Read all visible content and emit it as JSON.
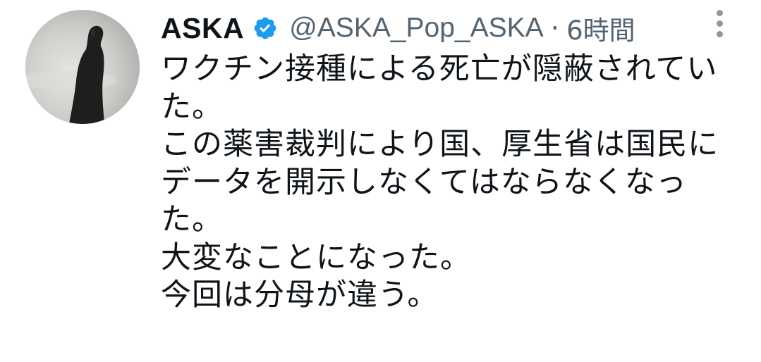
{
  "author": {
    "display_name": "ASKA",
    "handle": "@ASKA_Pop_ASKA",
    "separator": "·",
    "timestamp": "6時間",
    "verified_icon": "verified-badge-icon",
    "avatar_icon": "silhouette-avatar"
  },
  "tweet": {
    "lines": [
      "ワクチン接種による死亡が隠蔽されてい",
      "た。",
      "この薬害裁判により国、厚生省は国民に",
      "データを開示しなくてはならなくなっ",
      "た。",
      "大変なことになった。",
      "今回は分母が違う。"
    ]
  },
  "actions": {
    "more_icon": "more-vertical-icon"
  },
  "colors": {
    "text": "#0f1419",
    "muted": "#536471",
    "verified": "#1d9bf0"
  }
}
